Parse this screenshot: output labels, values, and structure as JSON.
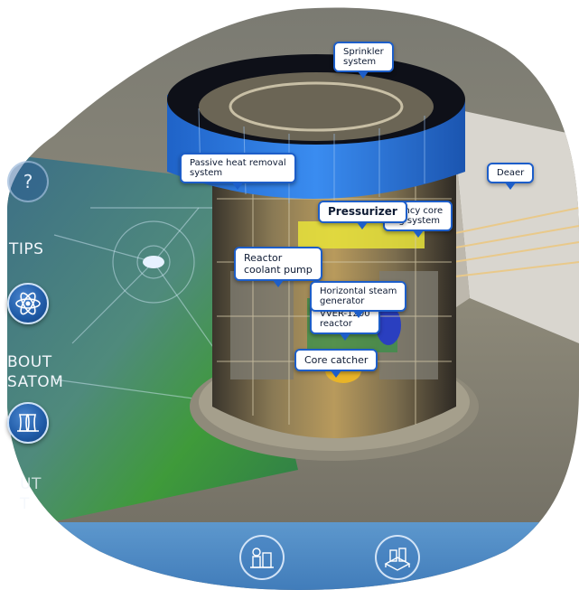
{
  "colors": {
    "accent_blue": "#1d5ec9",
    "dome_blue": "#2f7fe0",
    "bottom_bar": "#4a8ccc",
    "floor_green": "#3f9a3a"
  },
  "sidebar": {
    "help_icon": "question-mark-icon",
    "tips_label": "TIPS",
    "tips_icon": "atom-icon",
    "about_label": "BOUT\nSATOM",
    "about_icon": "power-plant-icon",
    "third_label": "UT\nT"
  },
  "callouts": {
    "sprinkler": "Sprinkler\nsystem",
    "passive_heat": "Passive heat removal\nsystem",
    "deaerator": "Deaer",
    "pressurizer": "Pressurizer",
    "emergency_core": "gency core\nng system",
    "reactor_pump": "Reactor\ncoolant pump",
    "steam_generator": "Horizontal steam\ngenerator",
    "vver_reactor": "VVER-1200\nreactor",
    "core_catcher": "Core catcher"
  },
  "bottom_bar": {
    "buttons": [
      "components-icon",
      "plant-overview-icon"
    ]
  }
}
